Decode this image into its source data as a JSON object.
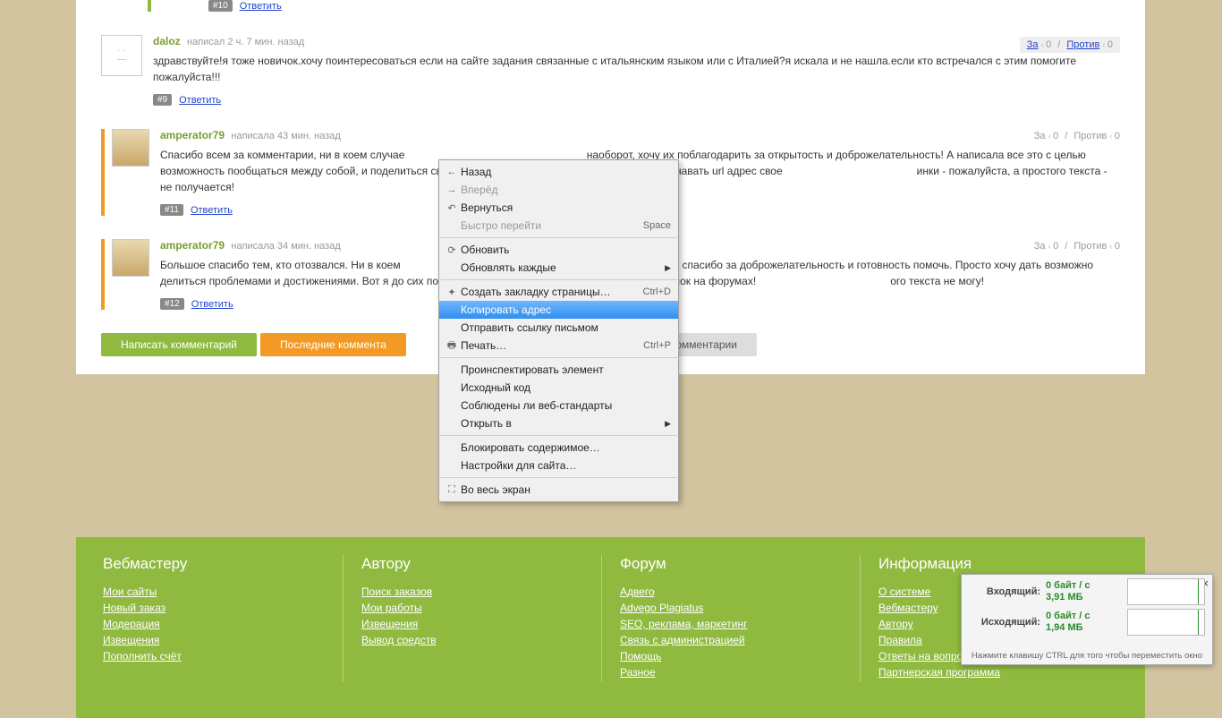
{
  "comments": [
    {
      "id": "c10",
      "tag": "#10",
      "reply_label": "Ответить",
      "accent": "green",
      "avatar": "orange-av",
      "vote": null
    },
    {
      "id": "c9",
      "user": "daloz",
      "meta_prefix": "написал",
      "time": "2 ч. 7 мин. назад",
      "accent": "none",
      "avatar": "blank-av",
      "tag": "#9",
      "reply_label": "Ответить",
      "text": "здравствуйте!я тоже новичок.хочу поинтересоваться если на сайте задания связанные с итальянским языком или с Италией?я искала и не нашла.если кто встречался с этим помогите пожалуйста!!!",
      "vote": {
        "za": "За",
        "za_n": "0",
        "pr": "Против",
        "pr_n": "0",
        "boxed": true
      }
    },
    {
      "id": "c11",
      "user": "amperator79",
      "meta_prefix": "написала",
      "time": "43 мин. назад",
      "accent": "orange",
      "avatar": "beige-av",
      "tag": "#11",
      "reply_label": "Ответить",
      "text": "Спасибо всем за комментарии, ни в коем случае                                                             наоборот, хочу их поблагодарить за открытость и доброжелательность! А написала все это с целью                                                         возможность пообщаться между собой, и поделиться своими проблемами. Вот я так и не научилась узнавать url адрес свое                                             инки - пожалуйста, а простого текста - не получается!",
      "vote": {
        "za": "За",
        "za_n": "0",
        "pr": "Против",
        "pr_n": "0",
        "boxed": false
      }
    },
    {
      "id": "c12",
      "user": "amperator79",
      "meta_prefix": "написала",
      "time": "34 мин. назад",
      "accent": "orange",
      "avatar": "beige-av",
      "tag": "#12",
      "reply_label": "Ответить",
      "text": "Большое спасибо тем, кто отозвался. Ни в коем                                                                     рот, говорю им спасибо за доброжелательность и готовность помочь. Просто хочу дать возможно                                                                      делиться проблемами и достижениями. Вот я до сих пор не научилась копировать url адрес своих ссылок на форумах!                                             ого текста не могу!",
      "vote": {
        "za": "За",
        "za_n": "0",
        "pr": "Против",
        "pr_n": "0",
        "boxed": false
      }
    }
  ],
  "tabs": {
    "write": "Написать комментарий",
    "latest": "Последние коммента",
    "all": "комментарии"
  },
  "context_menu": [
    {
      "icon": "←",
      "label": "Назад"
    },
    {
      "icon": "→",
      "label": "Вперёд",
      "disabled": true
    },
    {
      "icon": "↶",
      "label": "Вернуться"
    },
    {
      "icon": "",
      "label": "Быстро перейти",
      "shortcut": "Space",
      "disabled": true
    },
    {
      "sep": true
    },
    {
      "icon": "⟳",
      "label": "Обновить"
    },
    {
      "icon": "",
      "label": "Обновлять каждые",
      "submenu": true
    },
    {
      "sep": true
    },
    {
      "icon": "✦",
      "label": "Создать закладку страницы…",
      "shortcut": "Ctrl+D"
    },
    {
      "icon": "",
      "label": "Копировать адрес",
      "selected": true
    },
    {
      "icon": "",
      "label": "Отправить ссылку письмом"
    },
    {
      "icon": "🖶",
      "label": "Печать…",
      "shortcut": "Ctrl+P"
    },
    {
      "sep": true
    },
    {
      "icon": "",
      "label": "Проинспектировать элемент"
    },
    {
      "icon": "",
      "label": "Исходный код"
    },
    {
      "icon": "",
      "label": "Соблюдены ли веб-стандарты"
    },
    {
      "icon": "",
      "label": "Открыть в",
      "submenu": true
    },
    {
      "sep": true
    },
    {
      "icon": "",
      "label": "Блокировать содержимое…"
    },
    {
      "icon": "",
      "label": "Настройки для сайта…"
    },
    {
      "sep": true
    },
    {
      "icon": "⛶",
      "label": "Во весь экран"
    }
  ],
  "footer": {
    "col1": {
      "title": "Вебмастеру",
      "links": [
        "Мои сайты",
        "Новый заказ",
        "Модерация",
        "Извещения",
        "Пополнить счёт"
      ]
    },
    "col2": {
      "title": "Автору",
      "links": [
        "Поиск заказов",
        "Мои работы",
        "Извещения",
        "Вывод средств"
      ]
    },
    "col3": {
      "title": "Форум",
      "links": [
        "Адвего",
        "Advego Plagiatus",
        "SEO, реклама, маркетинг",
        "Связь с администрацией",
        "Помощь",
        "Разное"
      ]
    },
    "col4": {
      "title": "Информация",
      "links": [
        "О системе",
        "Вебмастеру",
        "Автору",
        "Правила",
        "Ответы на вопросы",
        "Партнерская программа"
      ]
    }
  },
  "net": {
    "in_label": "Входящий:",
    "in_rate": "0 байт / с",
    "in_total": "3,91 МБ",
    "out_label": "Исходящий:",
    "out_rate": "0 байт / с",
    "out_total": "1,94 МБ",
    "hint": "Нажмите клавишу CTRL для того чтобы переместить окно"
  }
}
